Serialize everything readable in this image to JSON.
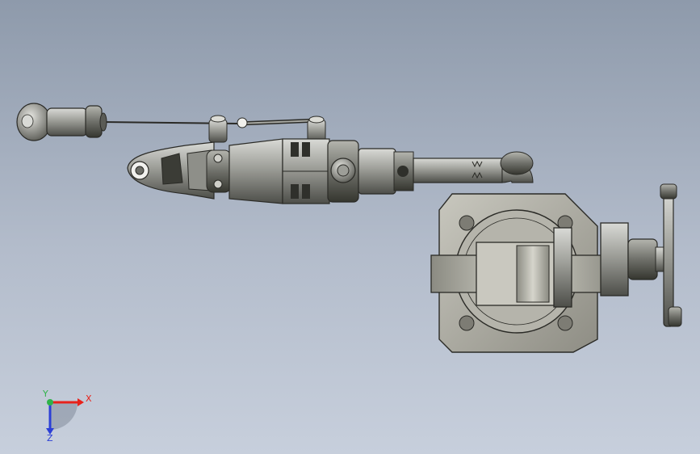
{
  "viewport": {
    "background_top": "#8e9aab",
    "background_bottom": "#c7cfdc"
  },
  "triad": {
    "x_label": "X",
    "y_label": "Y",
    "z_label": "Z",
    "x_color": "#e8221b",
    "y_color": "#2fb34a",
    "z_color": "#2c3fd6"
  },
  "model": {
    "icon": "cad-assembly-icon",
    "parts": [
      "handle-grip",
      "control-rod",
      "chuck-nose",
      "motor-body",
      "knurled-collar",
      "swivel-arm",
      "mounting-plate",
      "clamp-jaw",
      "clamp-screw",
      "t-handle"
    ]
  }
}
